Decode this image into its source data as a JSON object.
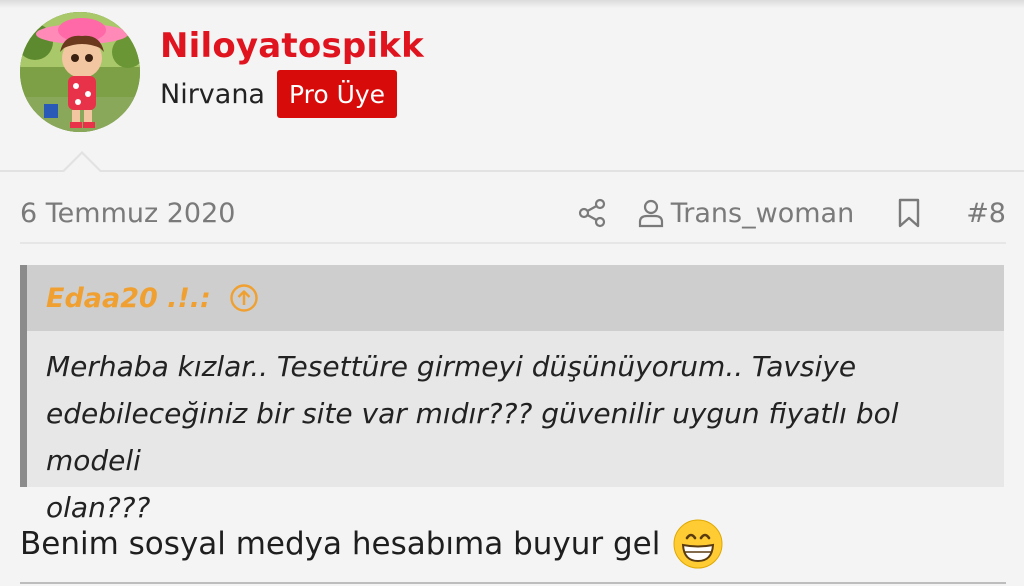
{
  "user": {
    "username": "Niloyatospikk",
    "title": "Nirvana",
    "badge": "Pro Üye"
  },
  "post": {
    "date": "6 Temmuz 2020",
    "reply_user": "Trans_woman",
    "number": "#8",
    "body": "Benim sosyal medya hesabıma buyur gel"
  },
  "quote": {
    "author": "Edaa20 .!.:",
    "lines": [
      "Merhaba kızlar.. Tesettüre girmeyi düşünüyorum.. Tavsiye",
      "edebileceğiniz bir site var mıdır??? güvenilir uygun fiyatlı bol modeli",
      "olan???"
    ]
  },
  "icons": {
    "share": "share-icon",
    "user": "user-icon",
    "bookmark": "bookmark-icon",
    "quote_jump": "arrow-up-circle-icon",
    "emoji": "grinning-face-icon"
  },
  "colors": {
    "username": "#e0141e",
    "badge_bg": "#d80b0b",
    "quote_author": "#f0a030"
  }
}
